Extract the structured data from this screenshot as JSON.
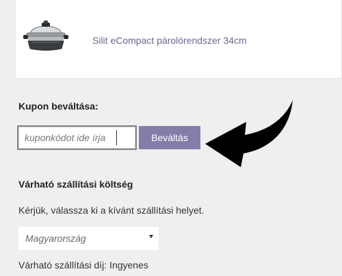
{
  "product": {
    "name": "Silit eCompact párolórendszer 34cm",
    "image_icon": "steamer-pot-image"
  },
  "coupon": {
    "title": "Kupon beváltása:",
    "input_placeholder": "kuponkódot ide írja",
    "button_label": "Beváltás",
    "pointer_icon": "curved-arrow-icon"
  },
  "shipping": {
    "title": "Várható szállítási költség",
    "instruction": "Kérjük, válassza ki a kívánt szállítási helyet.",
    "selected_country": "Magyarország",
    "cost_text": "Várható szállítási díj: Ingyenes"
  },
  "colors": {
    "accent": "#857ca9",
    "product_link": "#6d6592",
    "background": "#efefef"
  }
}
